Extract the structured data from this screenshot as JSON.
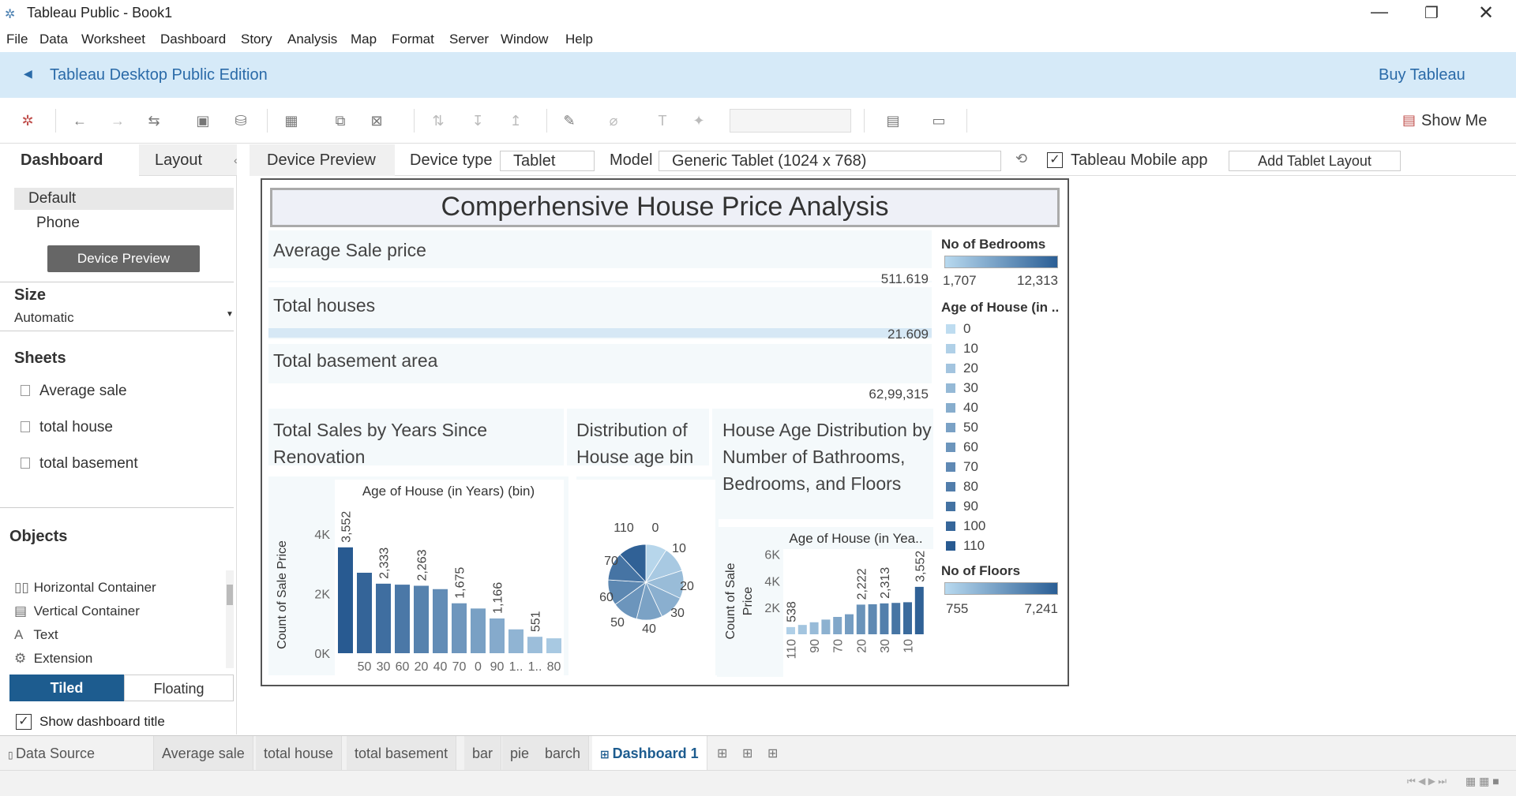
{
  "window": {
    "title": "Tableau Public - Book1"
  },
  "menu": [
    "File",
    "Data",
    "Worksheet",
    "Dashboard",
    "Story",
    "Analysis",
    "Map",
    "Format",
    "Server",
    "Window",
    "Help"
  ],
  "banner": {
    "edition": "Tableau Desktop Public Edition",
    "buy": "Buy Tableau"
  },
  "toolbar": {
    "show_me": "Show Me"
  },
  "left_panel": {
    "tabs": [
      "Dashboard",
      "Layout"
    ],
    "devices": [
      "Default",
      "Phone"
    ],
    "device_preview_button": "Device Preview",
    "size_header": "Size",
    "size_value": "Automatic",
    "sheets_header": "Sheets",
    "sheets": [
      "Average sale",
      "total house",
      "total basement"
    ],
    "objects_header": "Objects",
    "objects": [
      {
        "icon": "horizontal-container-icon",
        "label": "Horizontal Container"
      },
      {
        "icon": "vertical-container-icon",
        "label": "Vertical Container"
      },
      {
        "icon": "text-icon",
        "label": "Text"
      },
      {
        "icon": "extension-icon",
        "label": "Extension"
      }
    ],
    "tiled": "Tiled",
    "floating": "Floating",
    "show_title": "Show dashboard title",
    "show_title_checked": true
  },
  "device_bar": {
    "preview_tab": "Device Preview",
    "device_type_label": "Device type",
    "device_type_value": "Tablet",
    "model_label": "Model",
    "model_value": "Generic Tablet (1024 x 768)",
    "mobile_app_label": "Tableau Mobile app",
    "mobile_app_checked": true,
    "add_layout": "Add Tablet Layout"
  },
  "dashboard": {
    "title": "Comperhensive House Price Analysis",
    "kpis": [
      {
        "label": "Average Sale price",
        "value": "511.619"
      },
      {
        "label": "Total houses",
        "value": "21.609"
      },
      {
        "label": "Total basement area",
        "value": "62,99,315"
      }
    ],
    "legend_bedrooms": {
      "title": "No of Bedrooms",
      "min": "1,707",
      "max": "12,313"
    },
    "legend_age": {
      "title": "Age of House (in ..",
      "items": [
        "0",
        "10",
        "20",
        "30",
        "40",
        "50",
        "60",
        "70",
        "80",
        "90",
        "100",
        "110"
      ]
    },
    "legend_floors": {
      "title": "No of Floors",
      "min": "755",
      "max": "7,241"
    },
    "bar_panel_title": "Total Sales by Years Since Renovation",
    "pie_panel_title": "Distribution of House age bin",
    "barch_panel_title": "House Age Distribution by Number of Bathrooms, Bedrooms, and Floors"
  },
  "chart_data": [
    {
      "type": "bar",
      "title": "Age of House (in Years) (bin)",
      "ylabel": "Count of Sale Price",
      "categories": [
        "0",
        "50",
        "30",
        "60",
        "20",
        "40",
        "70",
        "0",
        "90",
        "1..",
        "1..",
        "80"
      ],
      "values": [
        3552,
        2700,
        2333,
        2300,
        2263,
        2150,
        1675,
        1500,
        1166,
        800,
        551,
        500
      ],
      "data_labels": [
        "3,552",
        "",
        "2,333",
        "",
        "2,263",
        "",
        "1,675",
        "",
        "1,166",
        "",
        "551",
        ""
      ],
      "yticks": [
        "0K",
        "2K",
        "4K"
      ],
      "ylim": [
        0,
        4500
      ]
    },
    {
      "type": "pie",
      "title": "Distribution of House age bin",
      "labels": [
        "0",
        "10",
        "20",
        "30",
        "40",
        "50",
        "60",
        "70",
        "110"
      ],
      "values": [
        9,
        11,
        12,
        11,
        11,
        11,
        11,
        12,
        12
      ]
    },
    {
      "type": "bar",
      "title": "Age of House (in Yea..",
      "ylabel": "Count of Sale Price",
      "categories": [
        "110",
        "90",
        "70",
        "20",
        "30",
        "10"
      ],
      "values": [
        538,
        700,
        900,
        1100,
        1300,
        1500,
        2222,
        2250,
        2313,
        2350,
        2400,
        3552
      ],
      "data_labels": [
        "538",
        "",
        "",
        "",
        "",
        "",
        "2,222",
        "",
        "2,313",
        "",
        "",
        "3,552"
      ],
      "yticks": [
        "2K",
        "4K",
        "6K"
      ],
      "ylim": [
        0,
        6500
      ]
    }
  ],
  "bottom_tabs": [
    "Data Source",
    "Average sale",
    "total house",
    "total basement",
    "bar",
    "pie",
    "barch",
    "Dashboard 1"
  ]
}
